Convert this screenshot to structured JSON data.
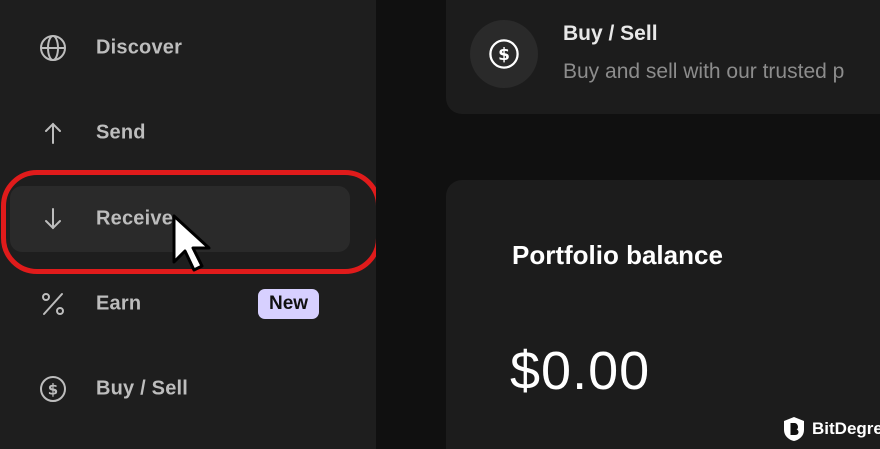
{
  "sidebar": {
    "items": [
      {
        "label": "Discover",
        "icon": "globe-icon"
      },
      {
        "label": "Send",
        "icon": "arrow-up-icon"
      },
      {
        "label": "Receive",
        "icon": "arrow-down-icon",
        "active": true
      },
      {
        "label": "Earn",
        "icon": "percent-icon",
        "badge": "New"
      },
      {
        "label": "Buy / Sell",
        "icon": "dollar-circle-icon"
      }
    ]
  },
  "buy_sell_card": {
    "title": "Buy / Sell",
    "subtitle": "Buy and sell with our trusted p",
    "icon": "dollar-circle-icon"
  },
  "portfolio": {
    "title": "Portfolio balance",
    "value": "$0.00"
  },
  "watermark": {
    "text": "BitDegree"
  },
  "colors": {
    "highlight": "#e01b1b",
    "badge": "#d7d0ff",
    "sidebar_bg": "#1e1e1e",
    "card_bg": "#1c1c1c"
  }
}
